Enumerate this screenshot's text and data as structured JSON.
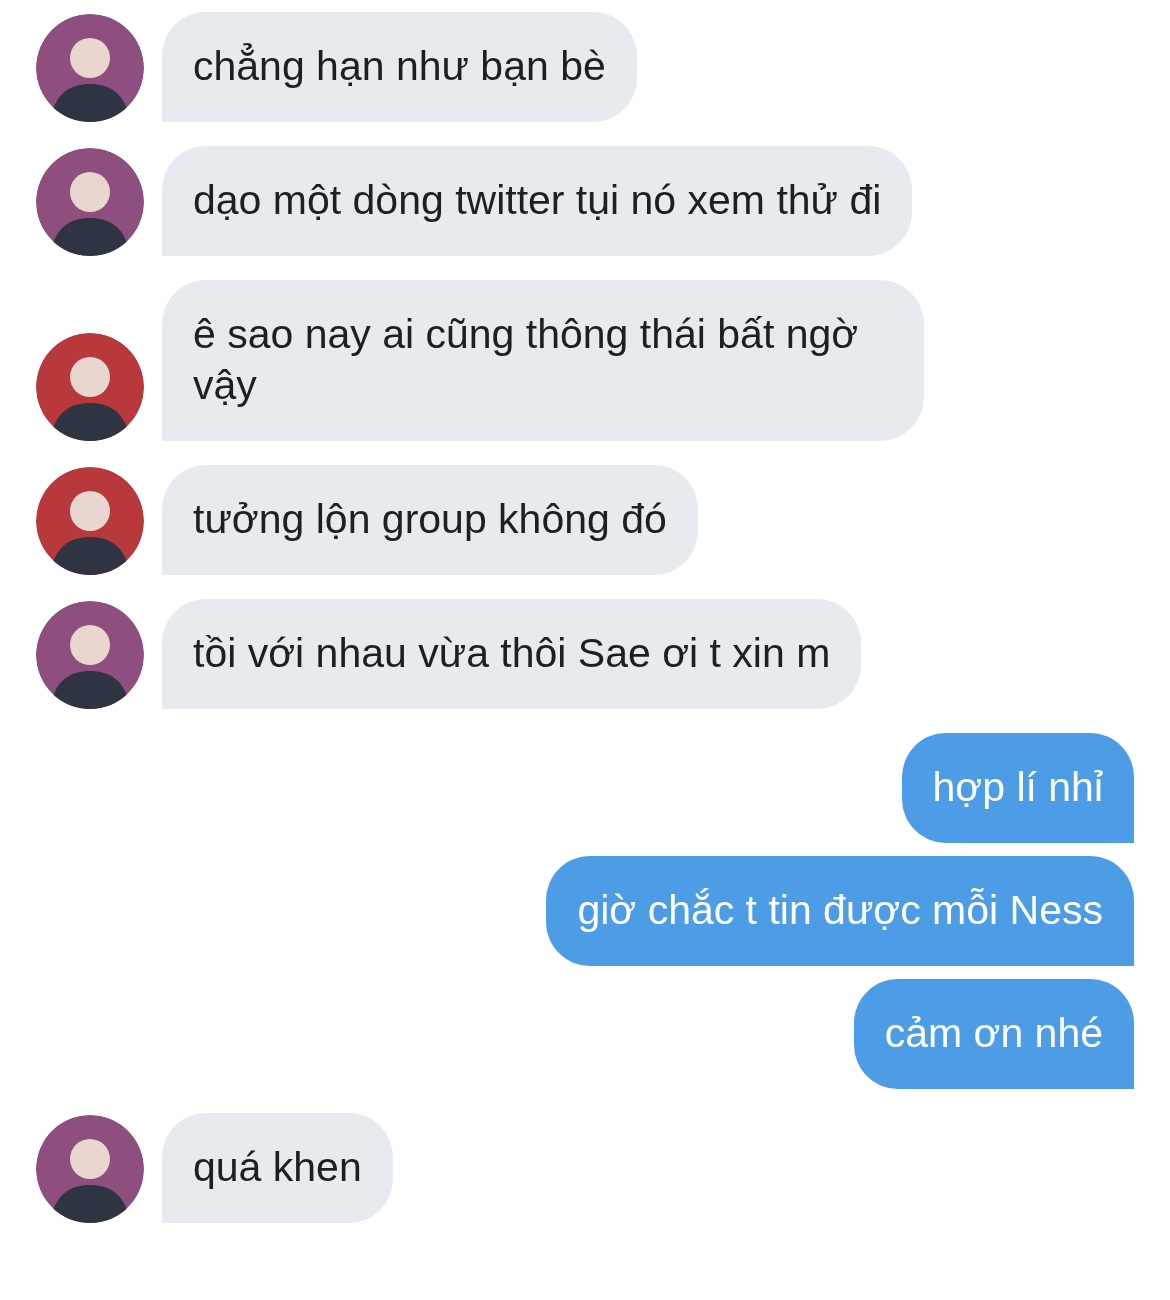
{
  "messages": [
    {
      "kind": "received",
      "color": "#8e4f7e",
      "text": "chẳng hạn như bạn bè"
    },
    {
      "kind": "received",
      "color": "#8e4f7e",
      "text": "dạo một dòng twitter tụi nó xem thử đi"
    },
    {
      "kind": "received",
      "color": "#b8383c",
      "text": "ê sao nay ai cũng thông thái bất ngờ vậy"
    },
    {
      "kind": "received",
      "color": "#b8383c",
      "text": "tưởng lộn group không đó"
    },
    {
      "kind": "received",
      "color": "#8e4f7e",
      "text": "tồi với nhau vừa thôi Sae ơi t xin m"
    },
    {
      "kind": "sent",
      "text": "hợp lí nhỉ"
    },
    {
      "kind": "sent",
      "text": "giờ chắc t tin được mỗi Ness"
    },
    {
      "kind": "sent",
      "text": "cảm ơn nhé"
    },
    {
      "kind": "received",
      "color": "#8e4f7e",
      "text": "quá khen"
    }
  ]
}
